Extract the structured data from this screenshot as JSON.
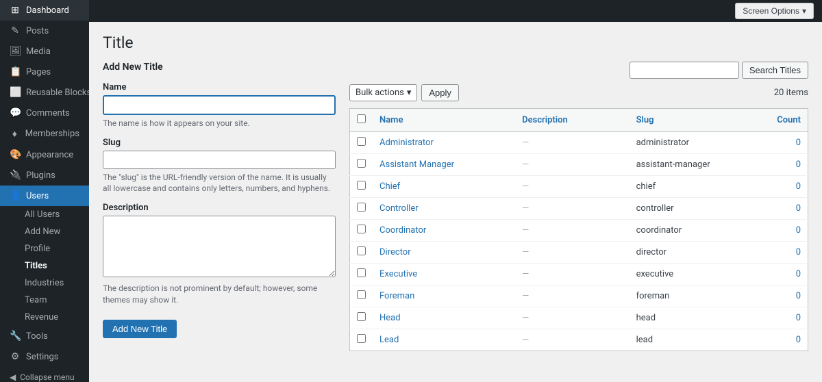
{
  "sidebar": {
    "logo": "🏠",
    "logo_label": "Dashboard",
    "items": [
      {
        "id": "dashboard",
        "label": "Dashboard",
        "icon": "⊞",
        "active": false
      },
      {
        "id": "posts",
        "label": "Posts",
        "icon": "📄",
        "active": false
      },
      {
        "id": "media",
        "label": "Media",
        "icon": "🖼",
        "active": false
      },
      {
        "id": "pages",
        "label": "Pages",
        "icon": "📋",
        "active": false
      },
      {
        "id": "reusable-blocks",
        "label": "Reusable Blocks",
        "icon": "⬜",
        "active": false
      },
      {
        "id": "comments",
        "label": "Comments",
        "icon": "💬",
        "active": false
      },
      {
        "id": "memberships",
        "label": "Memberships",
        "icon": "♦",
        "active": false
      },
      {
        "id": "appearance",
        "label": "Appearance",
        "icon": "🎨",
        "active": false
      },
      {
        "id": "plugins",
        "label": "Plugins",
        "icon": "🔌",
        "active": false
      },
      {
        "id": "users",
        "label": "Users",
        "icon": "👤",
        "active": true
      }
    ],
    "users_submenu": [
      {
        "id": "all-users",
        "label": "All Users"
      },
      {
        "id": "add-new",
        "label": "Add New"
      },
      {
        "id": "profile",
        "label": "Profile"
      },
      {
        "id": "titles",
        "label": "Titles",
        "active": true
      },
      {
        "id": "industries",
        "label": "Industries"
      },
      {
        "id": "team",
        "label": "Team"
      },
      {
        "id": "revenue",
        "label": "Revenue"
      }
    ],
    "tools_label": "Tools",
    "tools_icon": "🔧",
    "settings_label": "Settings",
    "settings_icon": "⚙",
    "collapse_label": "Collapse menu",
    "collapse_icon": "◀"
  },
  "topbar": {
    "screen_options": "Screen Options",
    "chevron": "▾"
  },
  "page": {
    "title": "Title",
    "add_form": {
      "heading": "Add New Title",
      "name_label": "Name",
      "name_hint": "The name is how it appears on your site.",
      "slug_label": "Slug",
      "slug_hint": "The \"slug\" is the URL-friendly version of the name. It is usually all lowercase and contains only letters, numbers, and hyphens.",
      "description_label": "Description",
      "description_hint": "The description is not prominent by default; however, some themes may show it.",
      "submit_label": "Add New Title"
    },
    "toolbar": {
      "bulk_label": "Bulk actions",
      "apply_label": "Apply",
      "search_placeholder": "",
      "search_button": "Search Titles",
      "items_count": "20 items"
    },
    "table": {
      "columns": [
        {
          "id": "name",
          "label": "Name"
        },
        {
          "id": "description",
          "label": "Description"
        },
        {
          "id": "slug",
          "label": "Slug"
        },
        {
          "id": "count",
          "label": "Count"
        }
      ],
      "rows": [
        {
          "name": "Administrator",
          "description": "—",
          "slug": "administrator",
          "count": "0"
        },
        {
          "name": "Assistant Manager",
          "description": "—",
          "slug": "assistant-manager",
          "count": "0"
        },
        {
          "name": "Chief",
          "description": "—",
          "slug": "chief",
          "count": "0"
        },
        {
          "name": "Controller",
          "description": "—",
          "slug": "controller",
          "count": "0"
        },
        {
          "name": "Coordinator",
          "description": "—",
          "slug": "coordinator",
          "count": "0"
        },
        {
          "name": "Director",
          "description": "—",
          "slug": "director",
          "count": "0"
        },
        {
          "name": "Executive",
          "description": "—",
          "slug": "executive",
          "count": "0"
        },
        {
          "name": "Foreman",
          "description": "—",
          "slug": "foreman",
          "count": "0"
        },
        {
          "name": "Head",
          "description": "—",
          "slug": "head",
          "count": "0"
        },
        {
          "name": "Lead",
          "description": "—",
          "slug": "lead",
          "count": "0"
        }
      ]
    }
  }
}
